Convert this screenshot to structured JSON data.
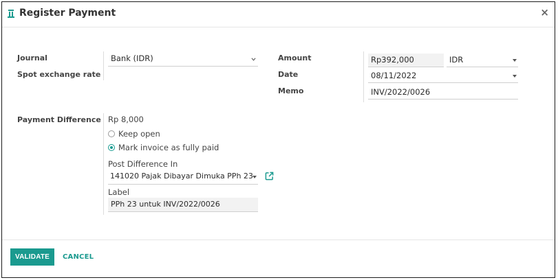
{
  "dialog": {
    "title": "Register Payment",
    "close_glyph": "×",
    "icon": "app-logo-icon"
  },
  "left": {
    "journal_label": "Journal",
    "journal_value": "Bank (IDR)",
    "spot_rate_label": "Spot exchange rate"
  },
  "right": {
    "amount_label": "Amount",
    "amount_value": "Rp392,000",
    "currency_value": "IDR",
    "date_label": "Date",
    "date_value": "08/11/2022",
    "memo_label": "Memo",
    "memo_value": "INV/2022/0026"
  },
  "difference": {
    "label": "Payment Difference",
    "amount": "Rp 8,000",
    "options": [
      {
        "label": "Keep open",
        "selected": false
      },
      {
        "label": "Mark invoice as fully paid",
        "selected": true
      }
    ],
    "post_label": "Post Difference In",
    "post_value": "141020 Pajak Dibayar Dimuka PPh 23",
    "label_caption": "Label",
    "label_value": "PPh 23 untuk INV/2022/0026"
  },
  "footer": {
    "validate_label": "VALIDATE",
    "cancel_label": "CANCEL"
  },
  "colors": {
    "accent": "#1a9a8f",
    "text": "#2b2b2b",
    "input_bg": "#f2f2f2"
  }
}
